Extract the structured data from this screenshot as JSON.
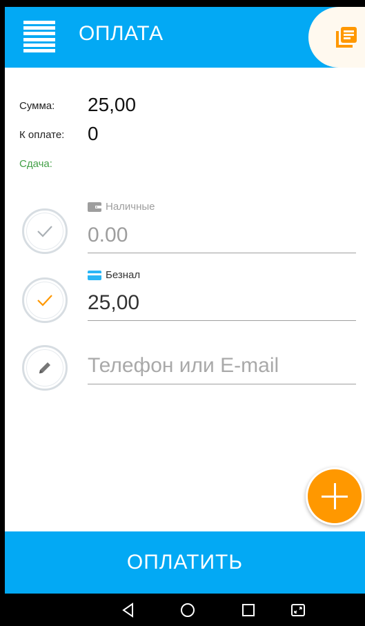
{
  "header": {
    "title": "ОПЛАТА",
    "menu_icon": "hamburger-menu-icon",
    "receipt_icon": "receipts-list-icon"
  },
  "summary": {
    "total_label": "Сумма:",
    "total_value": "25,00",
    "due_label": "К оплате:",
    "due_value": "0",
    "change_label": "Сдача:"
  },
  "payments": {
    "cash": {
      "label": "Наличные",
      "value": "0.00",
      "icon": "wallet-icon",
      "selected": false
    },
    "card": {
      "label": "Безнал",
      "value": "25,00",
      "icon": "card-icon",
      "selected": true
    }
  },
  "contact": {
    "placeholder": "Телефон или E-mail",
    "value": ""
  },
  "actions": {
    "add_icon": "plus-icon",
    "pay_label": "ОПЛАТИТЬ"
  },
  "colors": {
    "primary": "#03a9f4",
    "accent": "#ff9800",
    "change": "#43a047",
    "card": "#29b6f6"
  }
}
